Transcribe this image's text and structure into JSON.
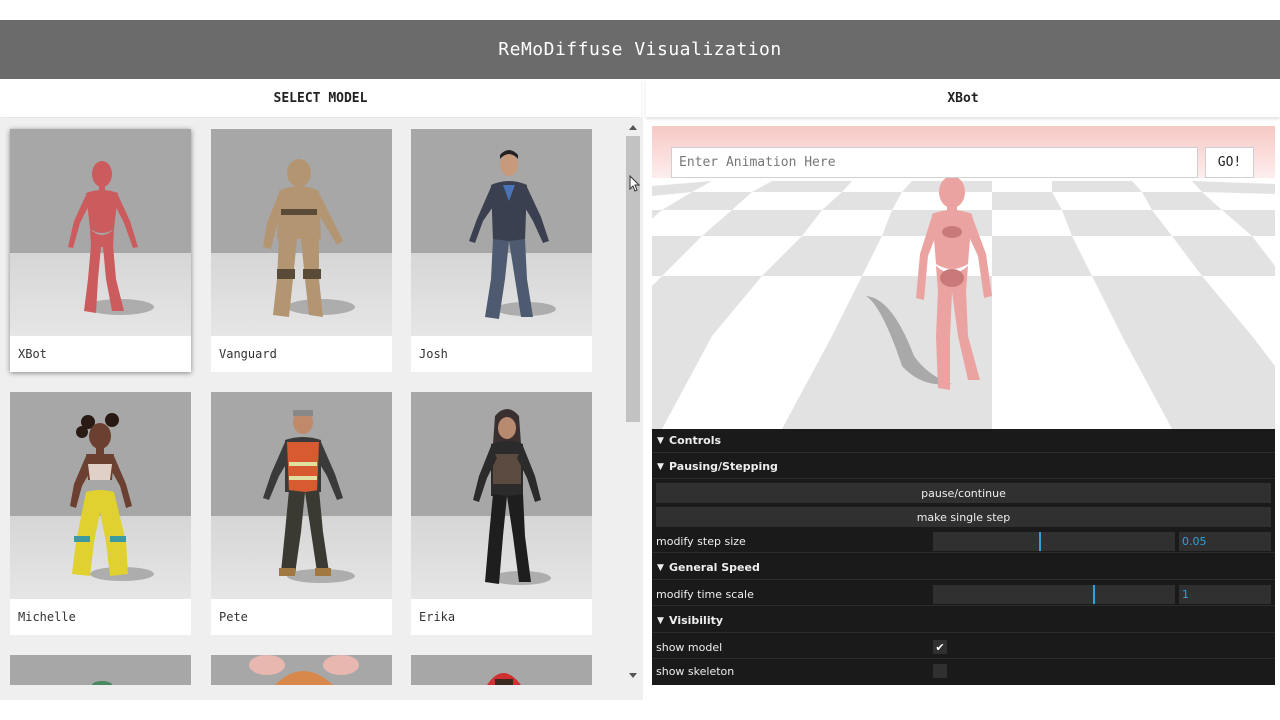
{
  "header": {
    "title": "ReMoDiffuse Visualization"
  },
  "left_panel": {
    "title": "SELECT MODEL",
    "models": [
      {
        "label": "XBot",
        "selected": true,
        "figure_color": "#cc5b5e"
      },
      {
        "label": "Vanguard",
        "selected": false,
        "figure_color": "#b49572"
      },
      {
        "label": "Josh",
        "selected": false,
        "figure_color": "#3a4050"
      },
      {
        "label": "Michelle",
        "selected": false,
        "figure_color": "#e0d030"
      },
      {
        "label": "Pete",
        "selected": false,
        "figure_color": "#d85a30"
      },
      {
        "label": "Erika",
        "selected": false,
        "figure_color": "#2b2b2b"
      }
    ]
  },
  "right_panel": {
    "title": "XBot",
    "animation_input": {
      "placeholder": "Enter Animation Here",
      "value": ""
    },
    "go_label": "GO!",
    "character_color": "#eba3a1"
  },
  "controls": {
    "root_label": "Controls",
    "pausing": {
      "label": "Pausing/Stepping",
      "pause_label": "pause/continue",
      "step_label": "make single step",
      "step_size_label": "modify step size",
      "step_size_value": "0.05",
      "step_size_fraction": 0.44
    },
    "speed": {
      "label": "General Speed",
      "time_scale_label": "modify time scale",
      "time_scale_value": "1",
      "time_scale_fraction": 0.66
    },
    "visibility": {
      "label": "Visibility",
      "show_model_label": "show model",
      "show_model_checked": true,
      "show_skeleton_label": "show skeleton",
      "show_skeleton_checked": false
    },
    "accent_color": "#2fa1d6"
  }
}
